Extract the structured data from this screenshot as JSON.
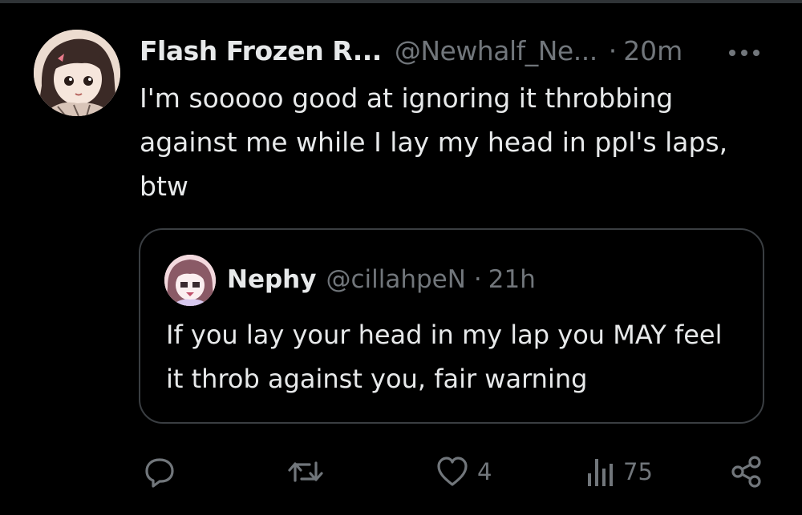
{
  "tweet": {
    "display_name": "Flash Frozen R...",
    "handle": "@Newhalf_Ne...",
    "separator": "·",
    "time": "20m",
    "text": "I'm sooooo good at ignoring it throbbing against me while I lay my head in ppl's laps, btw"
  },
  "quoted_tweet": {
    "display_name": "Nephy",
    "handle": "@cillahpeN",
    "separator": "·",
    "time": "21h",
    "text": "If you lay your head in my lap you MAY feel it throb against you, fair warning"
  },
  "actions": {
    "reply_count": "",
    "retweet_count": "",
    "like_count": "4",
    "views_count": "75"
  },
  "colors": {
    "background": "#000000",
    "primary_text": "#e7e9ea",
    "secondary_text": "#71767b",
    "border": "#3a3e42"
  },
  "icons": [
    "more-icon",
    "reply-icon",
    "retweet-icon",
    "like-icon",
    "views-icon",
    "share-icon"
  ]
}
